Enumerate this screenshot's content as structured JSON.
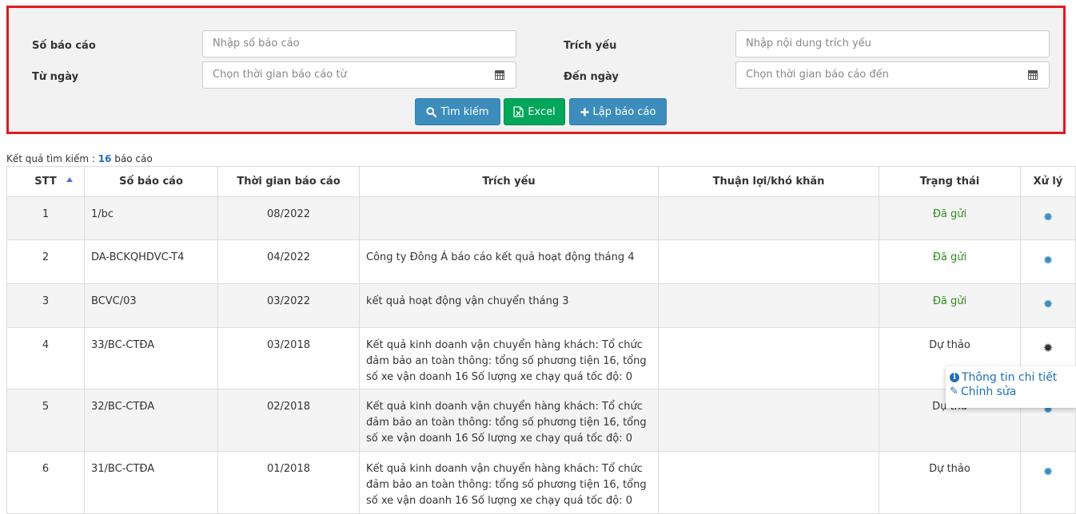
{
  "search": {
    "report_no_label": "Số báo cáo",
    "report_no_placeholder": "Nhập số báo cáo",
    "summary_label": "Trích yếu",
    "summary_placeholder": "Nhập nội dung trích yếu",
    "from_label": "Từ ngày",
    "from_placeholder": "Chọn thời gian báo cáo từ",
    "to_label": "Đến ngày",
    "to_placeholder": "Chọn thời gian báo cáo đến",
    "search_button": "Tìm kiếm",
    "excel_button": "Excel",
    "create_button": "Lập báo cáo"
  },
  "results": {
    "prefix": "Kết quả tìm kiếm : ",
    "count": "16",
    "suffix": " báo cáo"
  },
  "table": {
    "headers": [
      "STT",
      "Số báo cáo",
      "Thời gian báo cáo",
      "Trích yếu",
      "Thuận lợi/khó khăn",
      "Trạng thái",
      "Xử lý"
    ],
    "sort_column": "STT",
    "sort_direction": "ascending",
    "rows": [
      {
        "stt": "1",
        "report_no": "1/bc",
        "period": "08/2022",
        "summary": "",
        "notes": "",
        "status": "Đã gửi"
      },
      {
        "stt": "2",
        "report_no": "DA-BCKQHDVC-T4",
        "period": "04/2022",
        "summary": "Công ty Đông Á báo cáo kết quả hoạt động tháng 4",
        "notes": "",
        "status": "Đã gửi"
      },
      {
        "stt": "3",
        "report_no": "BCVC/03",
        "period": "03/2022",
        "summary": "kết quả hoạt động vận chuyển tháng 3",
        "notes": "",
        "status": "Đã gửi"
      },
      {
        "stt": "4",
        "report_no": "33/BC-CTĐA",
        "period": "03/2018",
        "summary": "Kết quả kinh doanh vận chuyển hàng khách: Tổ chức đảm bảo an toàn thông: tổng số phương tiện 16, tổng số xe vận doanh 16 Số lượng xe chạy quá tốc độ: 0",
        "notes": "",
        "status": "Dự thảo"
      },
      {
        "stt": "5",
        "report_no": "32/BC-CTĐA",
        "period": "02/2018",
        "summary": "Kết quả kinh doanh vận chuyển hàng khách: Tổ chức đảm bảo an toàn thông: tổng số phương tiện 16, tổng số xe vận doanh 16 Số lượng xe chạy quá tốc độ: 0",
        "notes": "",
        "status": "Dự thả"
      },
      {
        "stt": "6",
        "report_no": "31/BC-CTĐA",
        "period": "01/2018",
        "summary": "Kết quả kinh doanh vận chuyển hàng khách: Tổ chức đảm bảo an toàn thông: tổng số phương tiện 16, tổng số xe vận doanh 16 Số lượng xe chạy quá tốc độ: 0",
        "notes": "",
        "status": "Dự thảo"
      }
    ]
  },
  "action_menu": {
    "details": "Thông tin chi tiết",
    "edit": "Chỉnh sửa"
  },
  "colors": {
    "panel_border": "#e0191f",
    "primary": "#3c8dbc",
    "success": "#00a65a",
    "status_sent": "#2e8b1f",
    "link": "#1f6fb5"
  }
}
